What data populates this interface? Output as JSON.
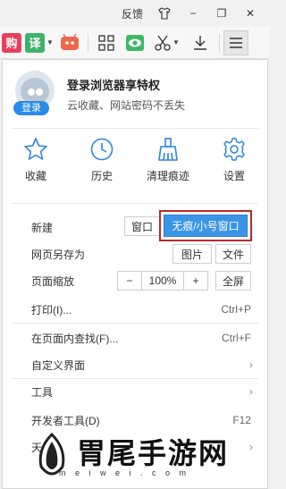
{
  "titlebar": {
    "feedback": "反馈",
    "shirt_icon": "shirt-icon",
    "minimize": "−",
    "restore": "❐",
    "close": "✕"
  },
  "toolbar": {
    "items": [
      {
        "name": "buy-icon",
        "glyph": "购",
        "color": "#e8405a"
      },
      {
        "name": "translate-icon",
        "glyph": "译",
        "color": "#3db36a"
      },
      {
        "name": "game-icon",
        "glyph": "◉",
        "color": "#f0664a"
      },
      {
        "name": "apps-grid-icon"
      },
      {
        "name": "eye-protect-icon"
      },
      {
        "name": "scissors-icon"
      },
      {
        "name": "download-icon"
      },
      {
        "name": "menu-icon"
      }
    ]
  },
  "login": {
    "title": "登录浏览器享特权",
    "subtitle": "云收藏、网站密码不丢失",
    "button": "登录"
  },
  "quick": [
    {
      "name": "favorites",
      "label": "收藏",
      "icon": "star-icon"
    },
    {
      "name": "history",
      "label": "历史",
      "icon": "clock-icon"
    },
    {
      "name": "clear-traces",
      "label": "清理痕迹",
      "icon": "broom-icon"
    },
    {
      "name": "settings",
      "label": "设置",
      "icon": "gear-icon"
    }
  ],
  "menu": {
    "new_label": "新建",
    "new_window": "窗口",
    "new_incognito": "无痕/小号窗口",
    "save_as_label": "网页另存为",
    "save_image": "图片",
    "save_file": "文件",
    "zoom_label": "页面缩放",
    "zoom_minus": "−",
    "zoom_value": "100%",
    "zoom_plus": "+",
    "fullscreen": "全屏",
    "print_label": "打印(I)...",
    "print_shortcut": "Ctrl+P",
    "find_label": "在页面内查找(F)...",
    "find_shortcut": "Ctrl+F",
    "custom_label": "自定义界面",
    "tools_label": "工具",
    "devtools_label": "开发者工具(D)",
    "devtools_shortcut": "F12",
    "partial_label": "天"
  },
  "colors": {
    "accent": "#2b8be8",
    "highlight_border": "#b8282c",
    "icon_blue": "#2f86d8"
  },
  "watermark": {
    "text": "胃尾手游网",
    "sub": "m e i w e i . c o m"
  }
}
